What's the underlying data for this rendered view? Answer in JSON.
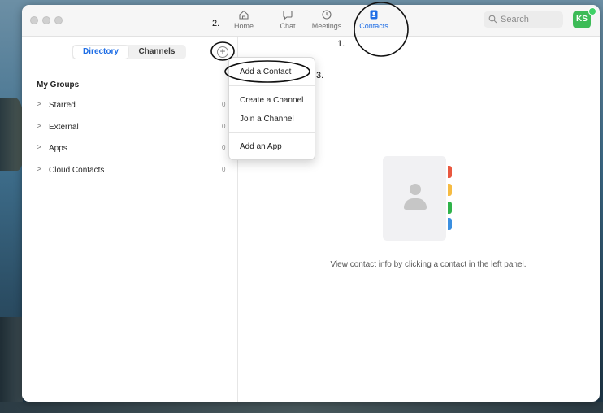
{
  "nav": {
    "items": [
      {
        "label": "Home",
        "icon": "home-icon"
      },
      {
        "label": "Chat",
        "icon": "chat-bubble-icon"
      },
      {
        "label": "Meetings",
        "icon": "clock-icon"
      },
      {
        "label": "Contacts",
        "icon": "contact-book-icon",
        "active": true
      }
    ]
  },
  "search": {
    "placeholder": "Search"
  },
  "user": {
    "initials": "KS",
    "status_color": "#3fd267"
  },
  "sidebar": {
    "tabs": {
      "directory": "Directory",
      "channels": "Channels"
    },
    "add_glyph": "+",
    "groups_title": "My Groups",
    "groups": [
      {
        "name": "Starred",
        "count": "0"
      },
      {
        "name": "External",
        "count": "0"
      },
      {
        "name": "Apps",
        "count": "0"
      },
      {
        "name": "Cloud Contacts",
        "count": "0"
      }
    ]
  },
  "menu": {
    "items": [
      "Add a Contact",
      "Create a Channel",
      "Join a Channel",
      "Add an App"
    ]
  },
  "empty_state": {
    "message": "View contact info by clicking a contact in the left panel."
  },
  "annotations": {
    "step1": "1.",
    "step2": "2.",
    "step3": "3."
  },
  "colors": {
    "accent": "#1e6de5",
    "avatar": "#3dbb57",
    "tab_red": "#e9573f",
    "tab_yellow": "#f6bb42",
    "tab_green": "#2fb34a",
    "tab_blue": "#3b8fe0"
  }
}
